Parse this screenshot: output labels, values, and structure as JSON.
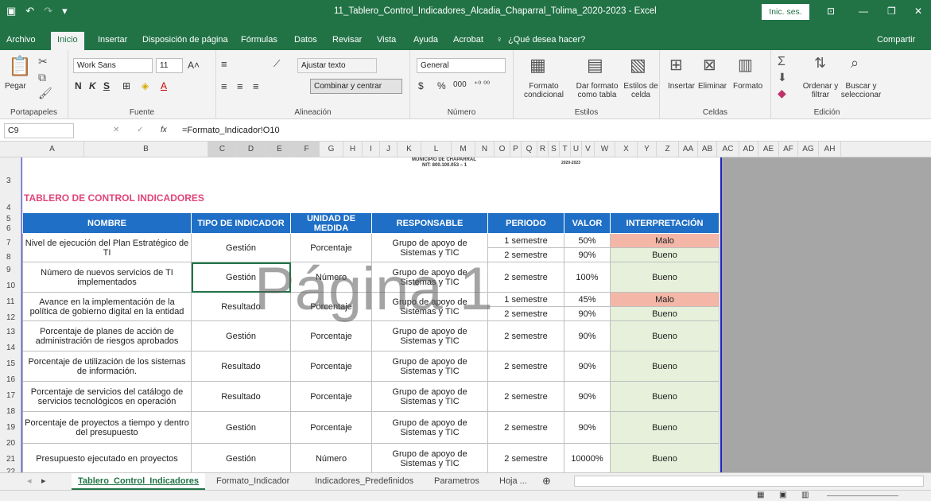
{
  "window": {
    "title": "11_Tablero_Control_Indicadores_Alcadia_Chaparral_Tolima_2020-2023  -  Excel",
    "signin": "Inic. ses."
  },
  "tabs": [
    "Archivo",
    "Inicio",
    "Insertar",
    "Disposición de página",
    "Fórmulas",
    "Datos",
    "Revisar",
    "Vista",
    "Ayuda",
    "Acrobat"
  ],
  "search": "¿Qué desea hacer?",
  "share": "Compartir",
  "ribbon": {
    "clipboard": {
      "paste": "Pegar",
      "label": "Portapapeles"
    },
    "font": {
      "name": "Work Sans",
      "size": "11",
      "bold": "N",
      "italic": "K",
      "underline": "S",
      "label": "Fuente"
    },
    "align": {
      "wrap": "Ajustar texto",
      "merge": "Combinar y centrar",
      "label": "Alineación"
    },
    "number": {
      "format": "General",
      "currency": "$",
      "percent": "%",
      "thousands": "000",
      "label": "Número"
    },
    "styles": {
      "conditional": "Formato condicional",
      "as_table": "Dar formato como tabla",
      "cell_styles": "Estilos de celda",
      "label": "Estilos"
    },
    "cells": {
      "insert": "Insertar",
      "delete": "Eliminar",
      "format": "Formato",
      "label": "Celdas"
    },
    "edit": {
      "sort": "Ordenar y filtrar",
      "find": "Buscar y seleccionar",
      "label": "Edición"
    }
  },
  "formula_bar": {
    "cell": "C9",
    "formula": "=Formato_Indicador!O10"
  },
  "columns": [
    "A",
    "B",
    "C",
    "D",
    "E",
    "F",
    "G",
    "H",
    "I",
    "J",
    "K",
    "L",
    "M",
    "N",
    "O",
    "P",
    "Q",
    "R",
    "S",
    "T",
    "U",
    "V",
    "W",
    "X",
    "Y",
    "Z",
    "AA",
    "AB",
    "AC",
    "AD",
    "AE",
    "AF",
    "AG",
    "AH"
  ],
  "rows": [
    "3",
    "4",
    "5",
    "6",
    "7",
    "8",
    "9",
    "10",
    "11",
    "12",
    "13",
    "14",
    "15",
    "16",
    "17",
    "18",
    "19",
    "20",
    "21",
    "22"
  ],
  "header": {
    "municipio": "MUNICIPIO DE CHAPARRAL",
    "nit": "NIT: 800.100.053 – 1",
    "years": "2020-2023"
  },
  "dashboard_title": "TABLERO DE CONTROL INDICADORES",
  "table_headers": [
    "NOMBRE",
    "TIPO DE INDICADOR",
    "UNIDAD DE MEDIDA",
    "RESPONSABLE",
    "PERIODO",
    "VALOR",
    "INTERPRETACIÓN"
  ],
  "indicators": [
    {
      "name": "Nivel de ejecución del Plan Estratégico de TI",
      "type": "Gestión",
      "unit": "Porcentaje",
      "resp": "Grupo de apoyo de Sistemas y TIC",
      "periods": [
        {
          "p": "1 semestre",
          "v": "50%",
          "i": "Malo"
        },
        {
          "p": "2 semestre",
          "v": "90%",
          "i": "Bueno"
        }
      ]
    },
    {
      "name": "Número de nuevos servicios de TI implementados",
      "type": "Gestión",
      "unit": "Número",
      "resp": "Grupo de apoyo de Sistemas y TIC",
      "periods": [
        {
          "p": "2 semestre",
          "v": "100%",
          "i": "Bueno"
        }
      ]
    },
    {
      "name": "Avance en la implementación de la política de gobierno digital en la entidad",
      "type": "Resultado",
      "unit": "Porcentaje",
      "resp": "Grupo de apoyo de Sistemas y TIC",
      "periods": [
        {
          "p": "1 semestre",
          "v": "45%",
          "i": "Malo"
        },
        {
          "p": "2 semestre",
          "v": "90%",
          "i": "Bueno"
        }
      ]
    },
    {
      "name": "Porcentaje de planes de acción de administración de riesgos aprobados",
      "type": "Gestión",
      "unit": "Porcentaje",
      "resp": "Grupo de apoyo de Sistemas y TIC",
      "periods": [
        {
          "p": "2 semestre",
          "v": "90%",
          "i": "Bueno"
        }
      ]
    },
    {
      "name": "Porcentaje de utilización de los sistemas de información.",
      "type": "Resultado",
      "unit": "Porcentaje",
      "resp": "Grupo de apoyo de Sistemas y TIC",
      "periods": [
        {
          "p": "2 semestre",
          "v": "90%",
          "i": "Bueno"
        }
      ]
    },
    {
      "name": "Porcentaje de servicios del catálogo de servicios tecnológicos en operación",
      "type": "Resultado",
      "unit": "Porcentaje",
      "resp": "Grupo de apoyo de Sistemas y TIC",
      "periods": [
        {
          "p": "2 semestre",
          "v": "90%",
          "i": "Bueno"
        }
      ]
    },
    {
      "name": "Porcentaje de proyectos a tiempo y dentro del presupuesto",
      "type": "Gestión",
      "unit": "Porcentaje",
      "resp": "Grupo de apoyo de Sistemas y TIC",
      "periods": [
        {
          "p": "2 semestre",
          "v": "90%",
          "i": "Bueno"
        }
      ]
    },
    {
      "name": "Presupuesto ejecutado en proyectos",
      "type": "Gestión",
      "unit": "Número",
      "resp": "Grupo de apoyo de Sistemas y TIC",
      "periods": [
        {
          "p": "2 semestre",
          "v": "10000%",
          "i": "Bueno"
        }
      ]
    }
  ],
  "watermark": "Página 1",
  "sheets": [
    "Tablero_Control_Indicadores",
    "Formato_Indicador",
    "Indicadores_Predefinidos",
    "Parametros",
    "Hoja ..."
  ],
  "colors": {
    "excel_green": "#217346",
    "header_blue": "#1f6fc6",
    "bad": "#f4b7a7",
    "good": "#e6f0da",
    "title_pink": "#e0457b"
  }
}
